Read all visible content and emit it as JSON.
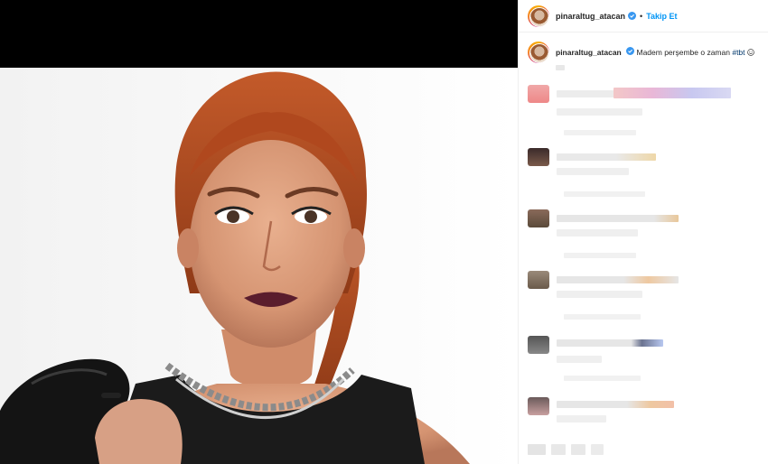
{
  "post_header": {
    "username": "pinaraltug_atacan",
    "separator": "•",
    "follow_label": "Takip Et"
  },
  "caption": {
    "username": "pinaraltug_atacan",
    "text": "Madem perşembe o zaman",
    "hashtag": "#tbt"
  },
  "icons": {
    "avatar": "profile-avatar",
    "verified": "verified-badge-icon",
    "emoji": "smile-emoji-icon"
  },
  "comments_count_visible": 6,
  "colors": {
    "accent": "#0095f6",
    "hashtag": "#00376b",
    "text": "#262626",
    "media_bar": "#000000"
  }
}
